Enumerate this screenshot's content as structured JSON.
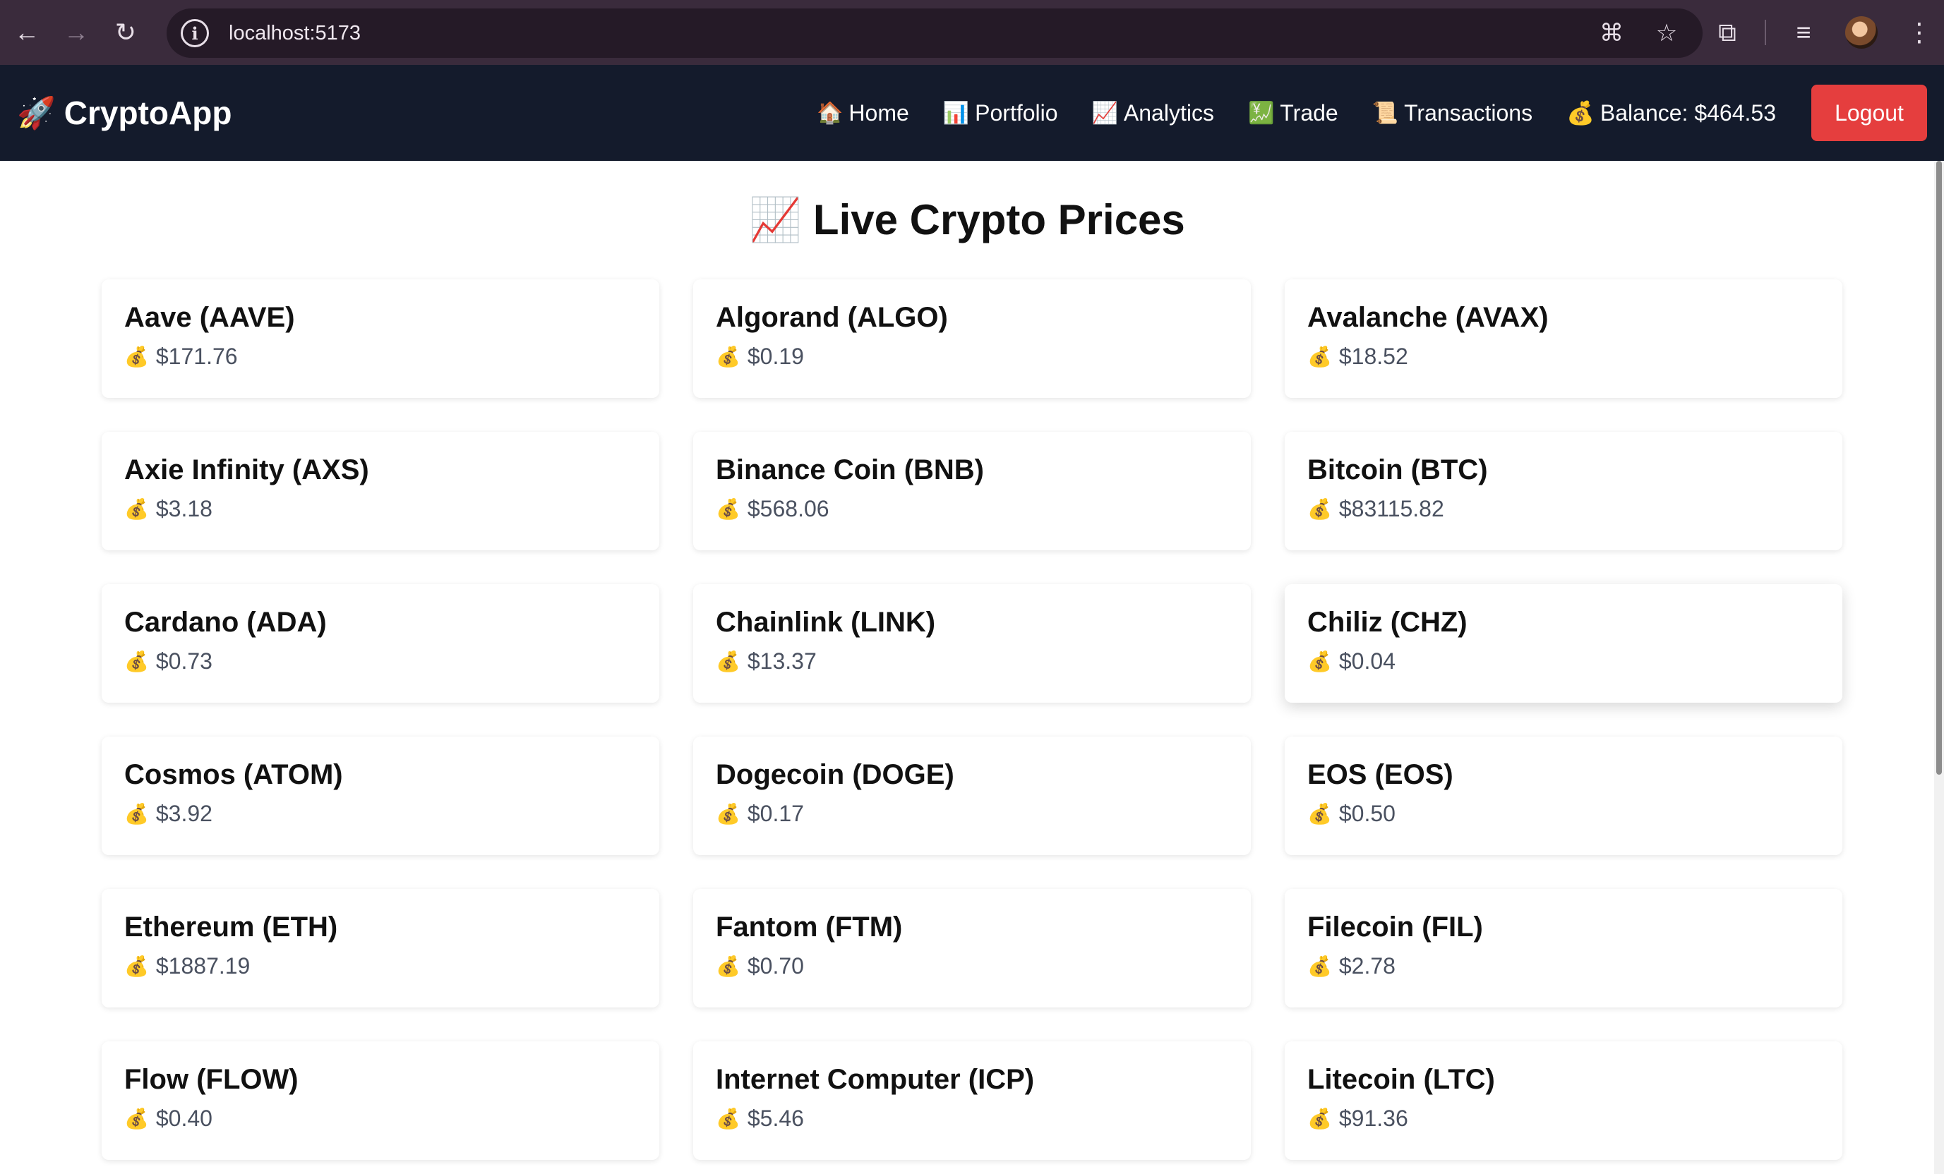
{
  "browser": {
    "url": "localhost:5173",
    "icons": {
      "back": "arrow-left-icon",
      "forward": "arrow-right-icon",
      "reload": "reload-icon",
      "site_info": "info-icon",
      "translate": "translate-icon",
      "bookmark": "star-icon",
      "extensions": "puzzle-icon",
      "media": "media-icon",
      "menu": "kebab-menu-icon"
    }
  },
  "navbar": {
    "brand_icon": "🚀",
    "brand": "CryptoApp",
    "links": [
      {
        "icon": "🏠",
        "label": "Home"
      },
      {
        "icon": "📊",
        "label": "Portfolio"
      },
      {
        "icon": "📈",
        "label": "Analytics"
      },
      {
        "icon": "💹",
        "label": "Trade"
      },
      {
        "icon": "📜",
        "label": "Transactions"
      }
    ],
    "balance_icon": "💰",
    "balance": "Balance: $464.53",
    "logout": "Logout",
    "logout_color": "#e53e3e",
    "bg_color": "#141b2c"
  },
  "page": {
    "title_icon": "📈",
    "title": "Live Crypto Prices",
    "price_icon": "💰",
    "coins": [
      {
        "name": "Aave (AAVE)",
        "price": "$171.76"
      },
      {
        "name": "Algorand (ALGO)",
        "price": "$0.19"
      },
      {
        "name": "Avalanche (AVAX)",
        "price": "$18.52"
      },
      {
        "name": "Axie Infinity (AXS)",
        "price": "$3.18"
      },
      {
        "name": "Binance Coin (BNB)",
        "price": "$568.06"
      },
      {
        "name": "Bitcoin (BTC)",
        "price": "$83115.82"
      },
      {
        "name": "Cardano (ADA)",
        "price": "$0.73"
      },
      {
        "name": "Chainlink (LINK)",
        "price": "$13.37"
      },
      {
        "name": "Chiliz (CHZ)",
        "price": "$0.04"
      },
      {
        "name": "Cosmos (ATOM)",
        "price": "$3.92"
      },
      {
        "name": "Dogecoin (DOGE)",
        "price": "$0.17"
      },
      {
        "name": "EOS (EOS)",
        "price": "$0.50"
      },
      {
        "name": "Ethereum (ETH)",
        "price": "$1887.19"
      },
      {
        "name": "Fantom (FTM)",
        "price": "$0.70"
      },
      {
        "name": "Filecoin (FIL)",
        "price": "$2.78"
      },
      {
        "name": "Flow (FLOW)",
        "price": "$0.40"
      },
      {
        "name": "Internet Computer (ICP)",
        "price": "$5.46"
      },
      {
        "name": "Litecoin (LTC)",
        "price": "$91.36"
      }
    ]
  }
}
